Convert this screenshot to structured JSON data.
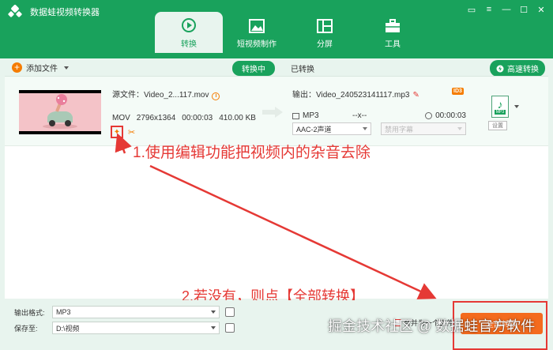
{
  "app": {
    "title": "数据蛙视频转换器"
  },
  "tabs": [
    {
      "label": "转换",
      "icon": "convert-icon"
    },
    {
      "label": "短视频制作",
      "icon": "image-icon"
    },
    {
      "label": "分屏",
      "icon": "split-screen-icon"
    },
    {
      "label": "工具",
      "icon": "toolbox-icon"
    }
  ],
  "toolbar": {
    "add_file": "添加文件",
    "converting": "转换中",
    "converted": "已转换",
    "high_speed": "高速转换"
  },
  "file": {
    "source_label": "源文件：",
    "source_name": "Video_2...117.mov",
    "format": "MOV",
    "resolution": "2796x1364",
    "duration": "00:00:03",
    "size": "410.00 KB",
    "output_label": "输出：",
    "output_name": "Video_240523141117.mp3",
    "out_format": "MP3",
    "out_resolution": "--x--",
    "out_duration": "00:00:03",
    "audio_track": "AAC-2声道",
    "subtitle": "禁用字幕",
    "id3_label": "ID3",
    "tile_format": "MP3",
    "tile_settings": "设置"
  },
  "annotations": {
    "step1": "1.使用编辑功能把视频内的杂音去除",
    "step2": "2.若没有，则点【全部转换】"
  },
  "bottom": {
    "output_format_label": "输出格式:",
    "output_format_value": "MP3",
    "save_to_label": "保存至:",
    "save_to_value": "D:\\视频",
    "merge_label": "合并为一个文件",
    "convert_all": "全部转换"
  },
  "watermark": "掘金技术社区 @ 数据蛙官方软件",
  "colors": {
    "brand": "#19a25c",
    "accent": "#f46b1e",
    "annotation": "#e53935"
  }
}
